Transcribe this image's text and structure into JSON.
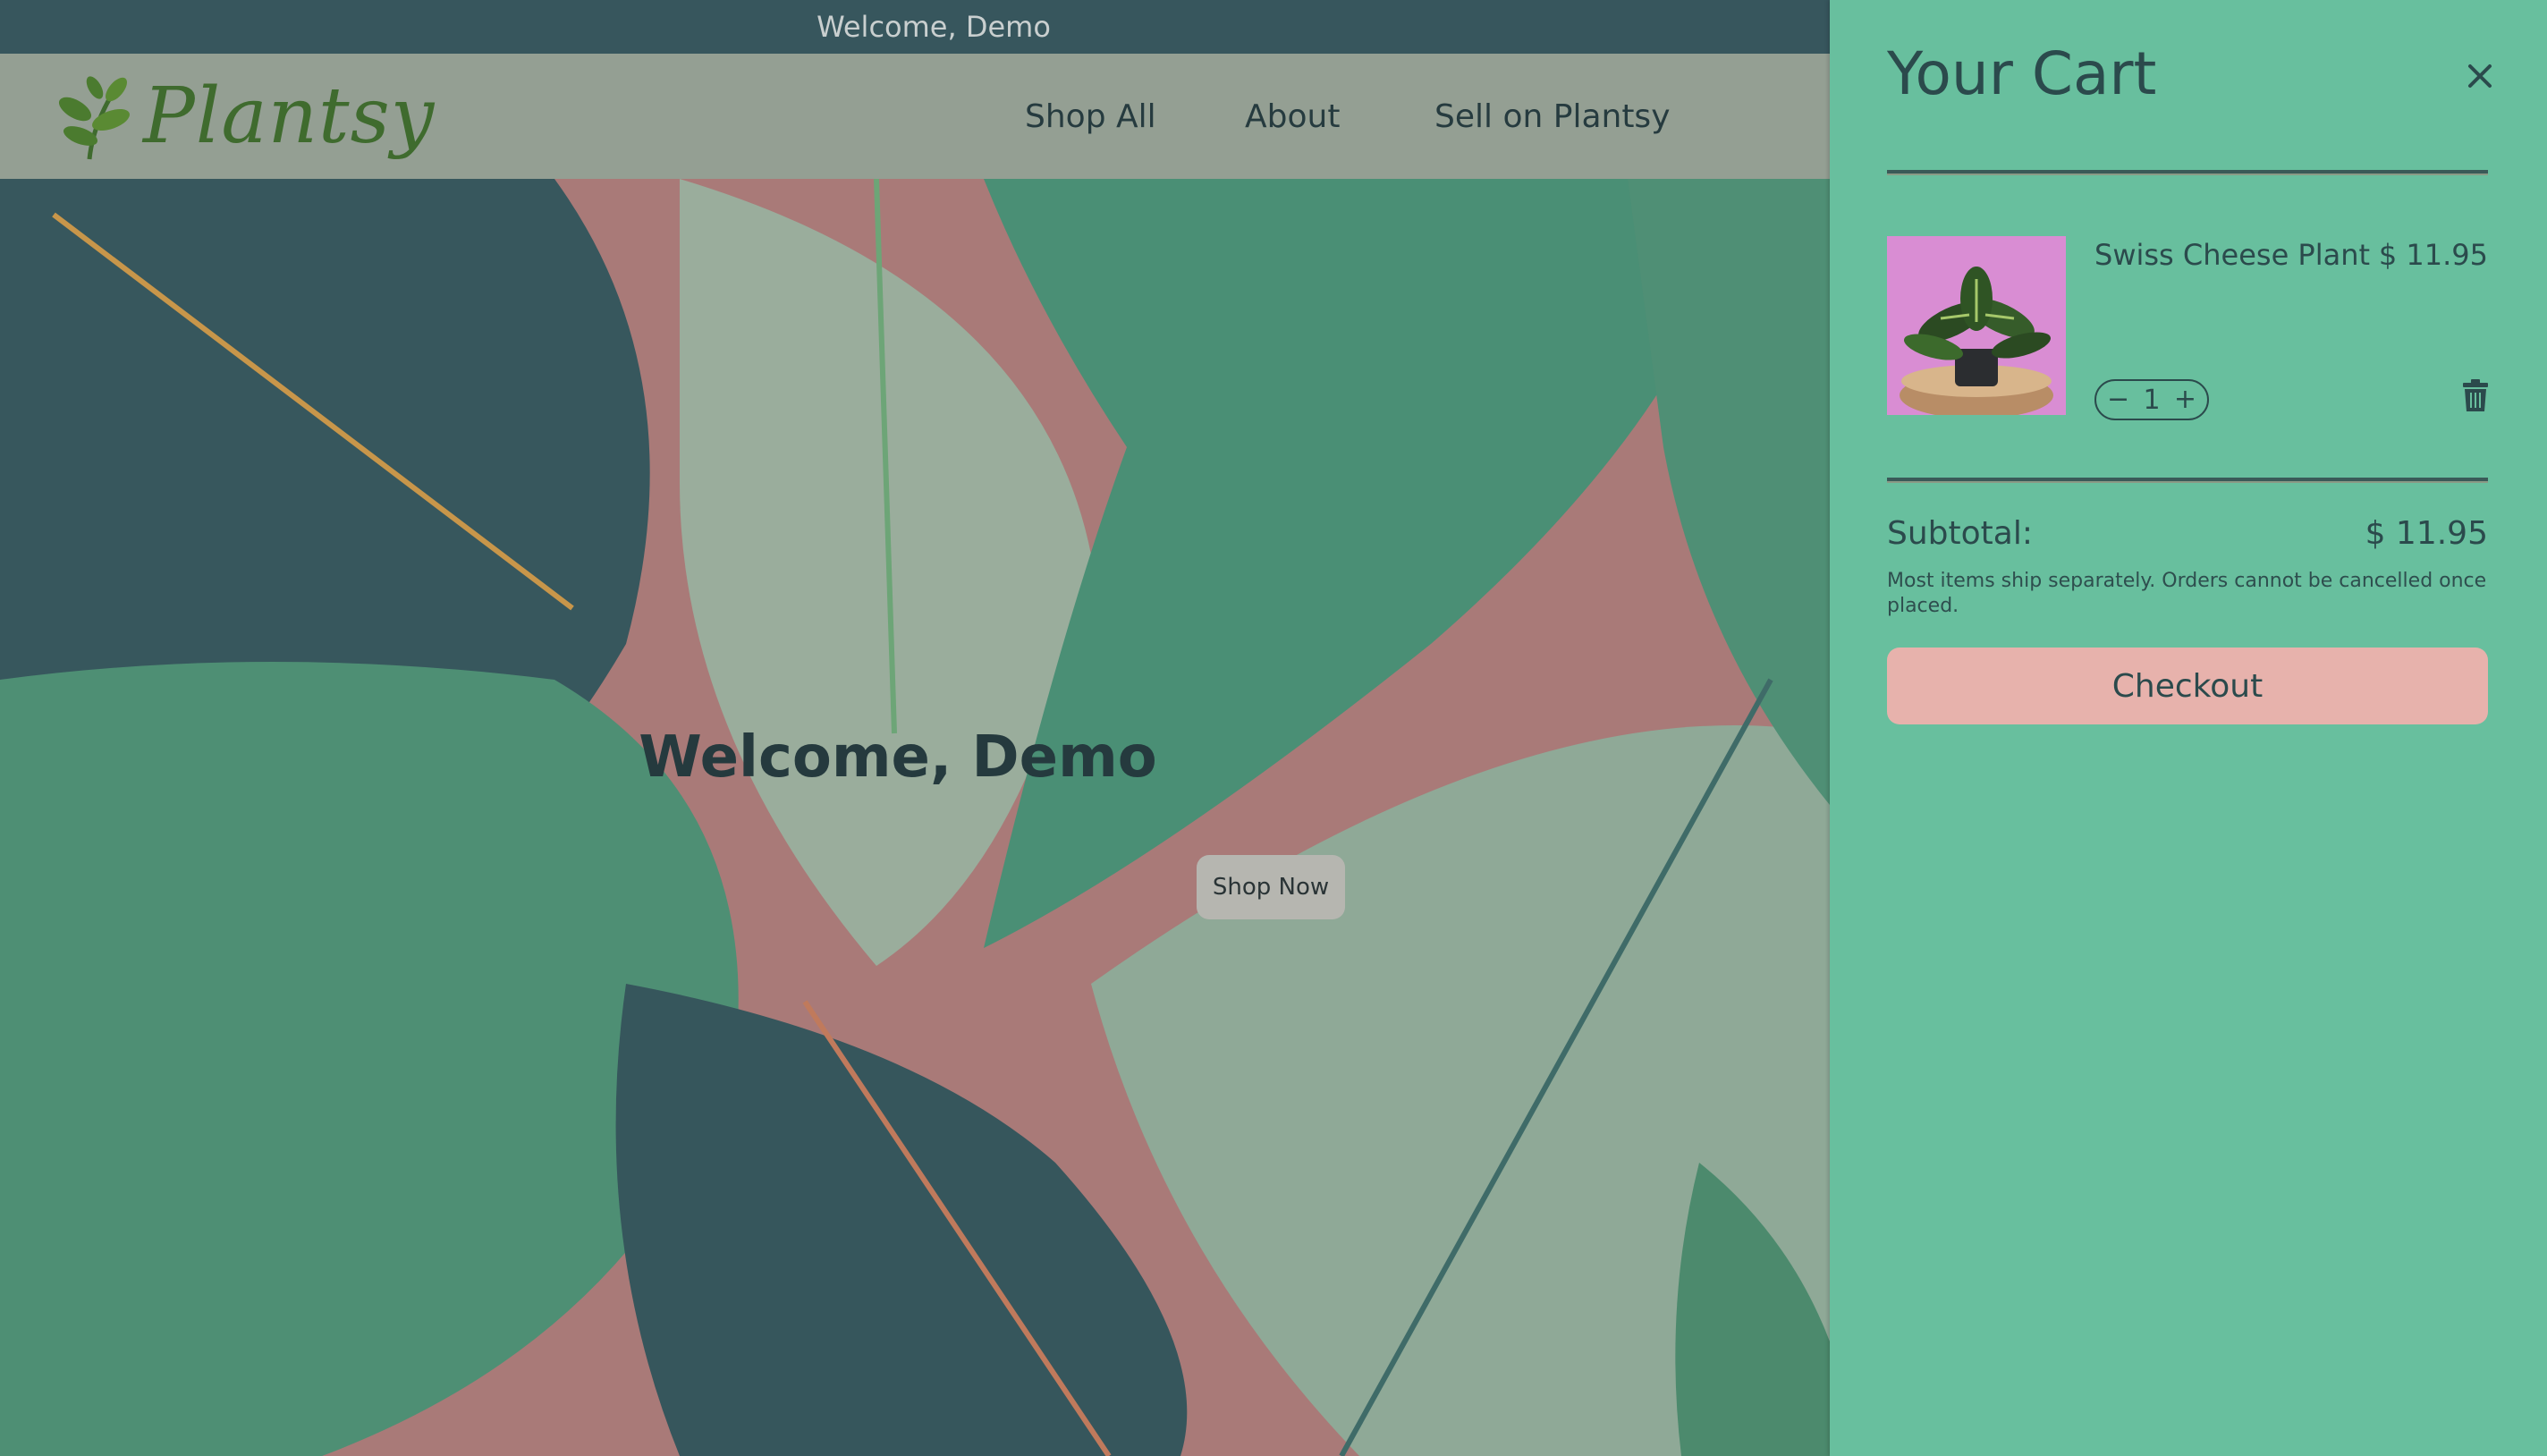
{
  "announcement": {
    "text": "Welcome, Demo"
  },
  "header": {
    "logo_text": "Plantsy",
    "nav": [
      {
        "label": "Shop All"
      },
      {
        "label": "About"
      },
      {
        "label": "Sell on Plantsy"
      }
    ]
  },
  "hero": {
    "title": "Welcome, Demo",
    "cta_label": "Shop Now"
  },
  "cart": {
    "title": "Your Cart",
    "close_icon": "close-icon",
    "items": [
      {
        "name": "Swiss Cheese Plant",
        "price": "$ 11.95",
        "quantity": "1"
      }
    ],
    "subtotal_label": "Subtotal:",
    "subtotal_value": "$ 11.95",
    "shipping_note": "Most items ship separately. Orders cannot be cancelled once placed.",
    "checkout_label": "Checkout"
  },
  "colors": {
    "announcement_bg": "#37565d",
    "header_bg": "#949f93",
    "drawer_bg": "#68bf9e",
    "checkout_bg": "#e7b2ac",
    "text_dark": "#2b4a4c"
  }
}
